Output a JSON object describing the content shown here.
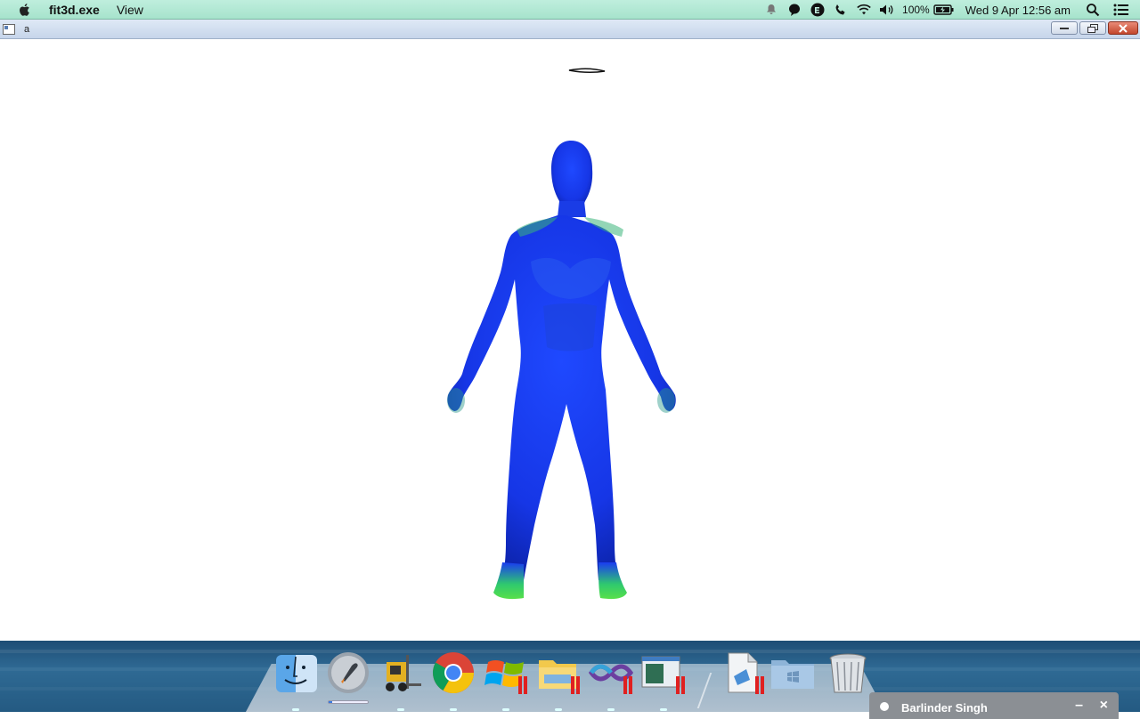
{
  "menubar": {
    "app_name": "fit3d.exe",
    "menu_items": [
      "View"
    ],
    "battery_percent": "100%",
    "datetime": "Wed 9 Apr  12:56 am",
    "status_icons": [
      "notification-icon",
      "chat-bubble-icon",
      "evernote-icon",
      "phone-icon",
      "wifi-icon",
      "volume-icon",
      "battery-icon",
      "spotlight-icon",
      "notification-center-icon"
    ]
  },
  "window": {
    "title": "a",
    "controls": [
      "minimize",
      "restore",
      "close"
    ]
  },
  "viewport": {
    "content": "3d-body-scan-model",
    "model_colors": {
      "primary": "#1a3cf0",
      "secondary": "#2fd36a",
      "accent": "#0f2aa8"
    }
  },
  "dock": {
    "apps": [
      {
        "name": "finder",
        "running": true
      },
      {
        "name": "launchpad",
        "running": false
      },
      {
        "name": "forklift",
        "running": true
      },
      {
        "name": "chrome",
        "running": true
      },
      {
        "name": "windows-app",
        "running": true
      },
      {
        "name": "windows-explorer",
        "running": true
      },
      {
        "name": "visual-studio",
        "running": true
      },
      {
        "name": "windows-terminal",
        "running": true
      },
      {
        "name": "document",
        "running": true
      },
      {
        "name": "windows-folder",
        "running": false
      },
      {
        "name": "trash",
        "running": false
      }
    ]
  },
  "notification": {
    "name": "Barlinder Singh"
  }
}
